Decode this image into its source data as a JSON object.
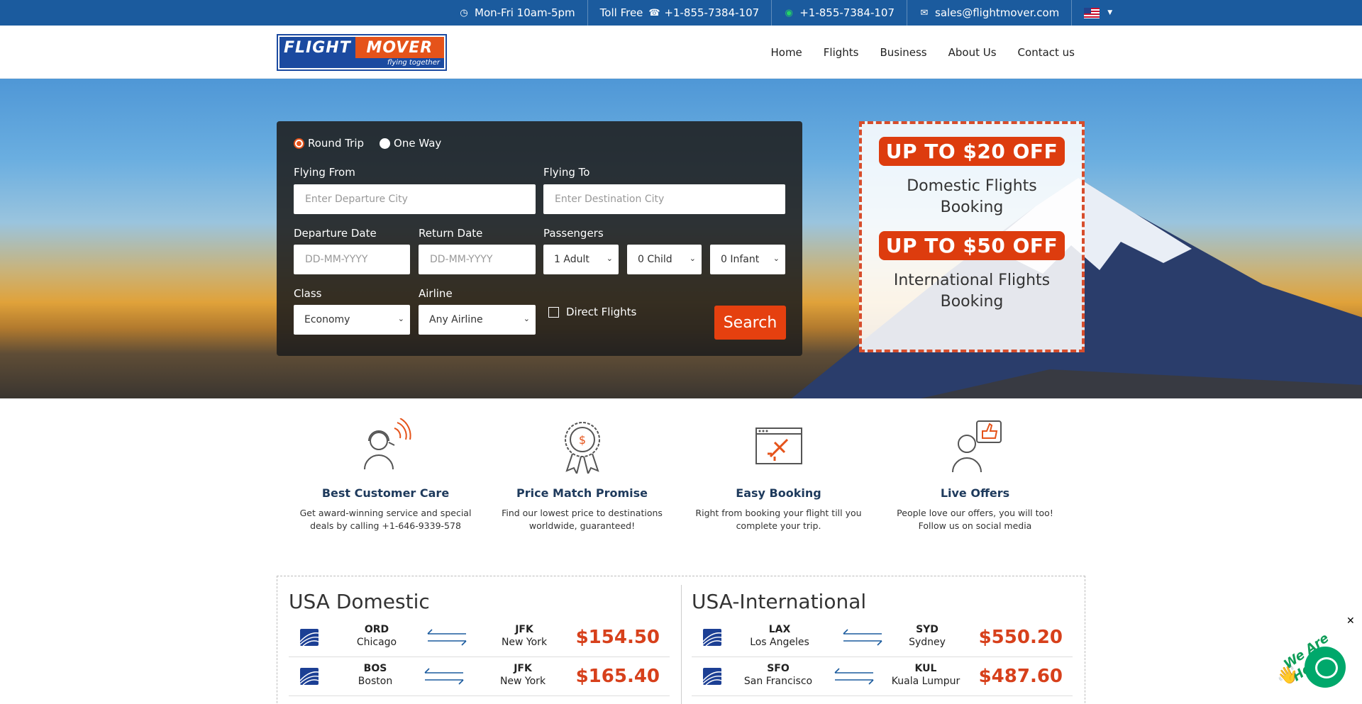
{
  "topbar": {
    "hours": "Mon-Fri 10am-5pm",
    "tollfree_label": "Toll Free",
    "tollfree_phone": "+1-855-7384-107",
    "whatsapp_phone": "+1-855-7384-107",
    "email": "sales@flightmover.com",
    "language_icon": "us-flag-icon"
  },
  "logo": {
    "word1": "FLIGHT",
    "word2": "MOVER",
    "tagline": "flying together"
  },
  "nav": [
    "Home",
    "Flights",
    "Business",
    "About Us",
    "Contact us"
  ],
  "search": {
    "trip_types": [
      "Round Trip",
      "One Way"
    ],
    "selected_trip": "Round Trip",
    "from_label": "Flying From",
    "from_placeholder": "Enter Departure City",
    "to_label": "Flying To",
    "to_placeholder": "Enter Destination City",
    "departure_label": "Departure Date",
    "departure_placeholder": "DD-MM-YYYY",
    "return_label": "Return Date",
    "return_placeholder": "DD-MM-YYYY",
    "passengers_label": "Passengers",
    "adults": "1 Adult",
    "children": "0 Child",
    "infants": "0 Infant",
    "class_label": "Class",
    "class_value": "Economy",
    "airline_label": "Airline",
    "airline_value": "Any Airline",
    "direct_label": "Direct Flights",
    "search_button": "Search"
  },
  "promo": {
    "offer1": "UP TO $20 OFF",
    "offer1_text": "Domestic Flights Booking",
    "offer2": "UP TO $50 OFF",
    "offer2_text": "International Flights Booking"
  },
  "features": [
    {
      "icon": "headset-support-icon",
      "title": "Best Customer Care",
      "text": "Get award-winning service and special deals by calling +1-646-9339-578"
    },
    {
      "icon": "price-badge-icon",
      "title": "Price Match Promise",
      "text": "Find our lowest price to destinations worldwide, guaranteed!"
    },
    {
      "icon": "booking-plane-icon",
      "title": "Easy Booking",
      "text": "Right from booking your flight till you complete your trip."
    },
    {
      "icon": "thumbs-up-agent-icon",
      "title": "Live Offers",
      "text": "People love our offers, you will too! Follow us on social media"
    }
  ],
  "deals": {
    "domestic_title": "USA Domestic",
    "international_title": "USA-International",
    "domestic": [
      {
        "from_code": "ORD",
        "from_city": "Chicago",
        "to_code": "JFK",
        "to_city": "New York",
        "price": "$154.50"
      },
      {
        "from_code": "BOS",
        "from_city": "Boston",
        "to_code": "JFK",
        "to_city": "New York",
        "price": "$165.40"
      }
    ],
    "international": [
      {
        "from_code": "LAX",
        "from_city": "Los Angeles",
        "to_code": "SYD",
        "to_city": "Sydney",
        "price": "$550.20"
      },
      {
        "from_code": "SFO",
        "from_city": "San Francisco",
        "to_code": "KUL",
        "to_city": "Kuala Lumpur",
        "price": "$487.60"
      }
    ]
  },
  "chat": {
    "label": "We Are Here!",
    "close": "✕"
  },
  "colors": {
    "brand_blue": "#1b5b9e",
    "accent_orange": "#e5400f",
    "price_red": "#d7401b"
  }
}
